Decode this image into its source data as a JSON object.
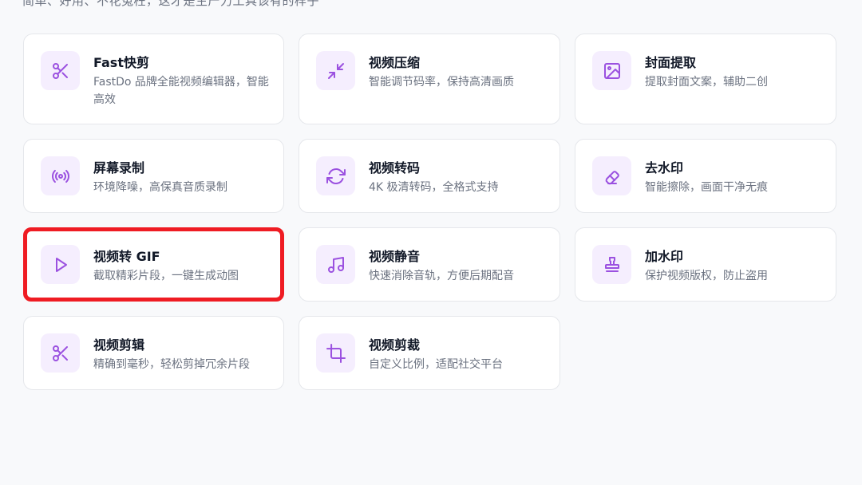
{
  "header": {
    "subtitle": "简单、好用、不花冤枉，这才是生产力工具该有的样子"
  },
  "tools": [
    {
      "title": "Fast快剪",
      "desc": "FastDo 品牌全能视频编辑器，智能高效",
      "icon": "scissors-icon"
    },
    {
      "title": "视频压缩",
      "desc": "智能调节码率，保持高清画质",
      "icon": "compress-icon"
    },
    {
      "title": "封面提取",
      "desc": "提取封面文案，辅助二创",
      "icon": "image-icon"
    },
    {
      "title": "屏幕录制",
      "desc": "环境降噪，高保真音质录制",
      "icon": "broadcast-icon"
    },
    {
      "title": "视频转码",
      "desc": "4K 极清转码，全格式支持",
      "icon": "refresh-icon"
    },
    {
      "title": "去水印",
      "desc": "智能擦除，画面干净无痕",
      "icon": "eraser-icon"
    },
    {
      "title": "视频转 GIF",
      "desc": "截取精彩片段，一键生成动图",
      "icon": "play-icon",
      "selected": true
    },
    {
      "title": "视频静音",
      "desc": "快速消除音轨，方便后期配音",
      "icon": "music-icon"
    },
    {
      "title": "加水印",
      "desc": "保护视频版权，防止盗用",
      "icon": "stamp-icon"
    },
    {
      "title": "视频剪辑",
      "desc": "精确到毫秒，轻松剪掉冗余片段",
      "icon": "scissors-icon"
    },
    {
      "title": "视频剪裁",
      "desc": "自定义比例，适配社交平台",
      "icon": "crop-icon"
    }
  ],
  "colors": {
    "accent": "#9b51e0",
    "icon_bg": "#f5eefe",
    "highlight": "#ef1c23"
  }
}
